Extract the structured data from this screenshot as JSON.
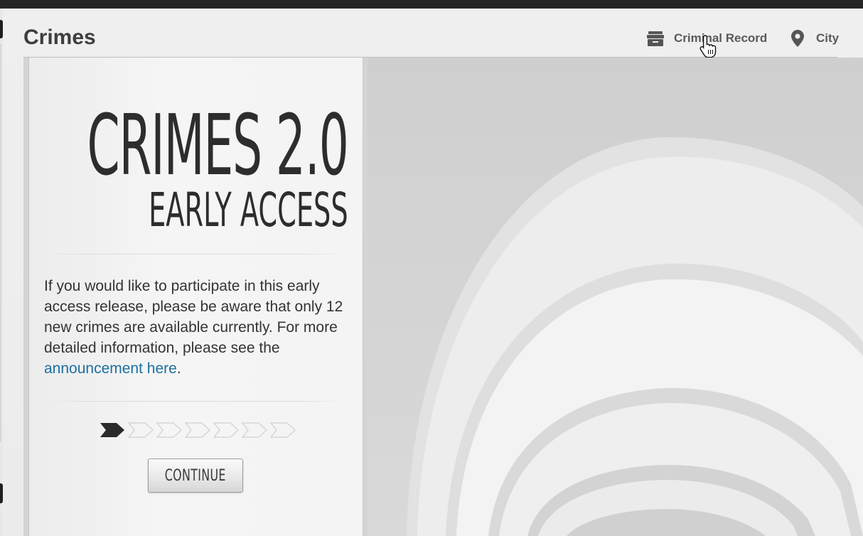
{
  "header": {
    "title": "Crimes",
    "links": [
      {
        "label": "Criminal Record",
        "icon": "archive-box-icon"
      },
      {
        "label": "City",
        "icon": "map-pin-icon"
      }
    ]
  },
  "promo": {
    "headline": "CRIMES 2.0",
    "subheadline": "EARLY ACCESS",
    "body_prefix": "If you would like to participate in this early access release, please be aware that only 12 new crimes are available currently. For more detailed information, please see the ",
    "link_text": "announcement here",
    "body_suffix": ".",
    "steps_current": 1,
    "steps_total": 7,
    "continue_label": "CONTINUE"
  },
  "colors": {
    "link": "#1d6fa0",
    "step_active": "#2a2a2a",
    "step_inactive": "#d6d6d6"
  }
}
